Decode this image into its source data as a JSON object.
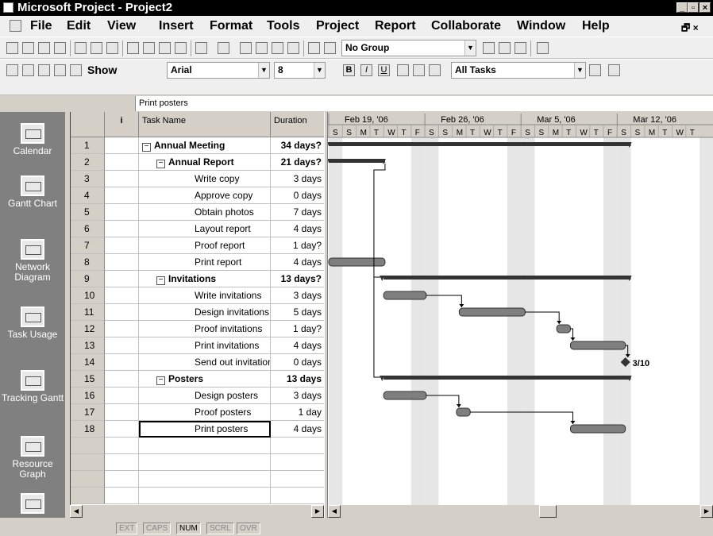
{
  "window": {
    "title": "Microsoft Project - Project2"
  },
  "menu": [
    "File",
    "Edit",
    "View",
    "Insert",
    "Format",
    "Tools",
    "Project",
    "Report",
    "Collaborate",
    "Window",
    "Help"
  ],
  "toolbar": {
    "group_value": "No Group",
    "show_label": "Show",
    "font_value": "Arial",
    "size_value": "8",
    "filter_value": "All Tasks"
  },
  "entry_bar": {
    "value": "Print posters"
  },
  "view_bar": [
    "Calendar",
    "Gantt Chart",
    "Network Diagram",
    "Task Usage",
    "Tracking Gantt",
    "Resource Graph"
  ],
  "table": {
    "headers": {
      "indicator": "i",
      "name": "Task Name",
      "duration": "Duration"
    },
    "rows": [
      {
        "id": "1",
        "name": "Annual Meeting",
        "duration": "34 days?",
        "level": 0,
        "summary": true
      },
      {
        "id": "2",
        "name": "Annual Report",
        "duration": "21 days?",
        "level": 1,
        "summary": true
      },
      {
        "id": "3",
        "name": "Write copy",
        "duration": "3 days",
        "level": 2,
        "summary": false
      },
      {
        "id": "4",
        "name": "Approve copy",
        "duration": "0 days",
        "level": 2,
        "summary": false
      },
      {
        "id": "5",
        "name": "Obtain photos",
        "duration": "7 days",
        "level": 2,
        "summary": false
      },
      {
        "id": "6",
        "name": "Layout report",
        "duration": "4 days",
        "level": 2,
        "summary": false
      },
      {
        "id": "7",
        "name": "Proof report",
        "duration": "1 day?",
        "level": 2,
        "summary": false
      },
      {
        "id": "8",
        "name": "Print report",
        "duration": "4 days",
        "level": 2,
        "summary": false
      },
      {
        "id": "9",
        "name": "Invitations",
        "duration": "13 days?",
        "level": 1,
        "summary": true
      },
      {
        "id": "10",
        "name": "Write invitations",
        "duration": "3 days",
        "level": 2,
        "summary": false
      },
      {
        "id": "11",
        "name": "Design invitations",
        "duration": "5 days",
        "level": 2,
        "summary": false
      },
      {
        "id": "12",
        "name": "Proof invitations",
        "duration": "1 day?",
        "level": 2,
        "summary": false
      },
      {
        "id": "13",
        "name": "Print invitations",
        "duration": "4 days",
        "level": 2,
        "summary": false
      },
      {
        "id": "14",
        "name": "Send out invitations",
        "duration": "0 days",
        "level": 2,
        "summary": false
      },
      {
        "id": "15",
        "name": "Posters",
        "duration": "13 days",
        "level": 1,
        "summary": true
      },
      {
        "id": "16",
        "name": "Design posters",
        "duration": "3 days",
        "level": 2,
        "summary": false
      },
      {
        "id": "17",
        "name": "Proof posters",
        "duration": "1 day",
        "level": 2,
        "summary": false
      },
      {
        "id": "18",
        "name": "Print posters",
        "duration": "4 days",
        "level": 2,
        "summary": false,
        "selected": true
      }
    ]
  },
  "gantt": {
    "weeks": [
      "Feb 19, '06",
      "Feb 26, '06",
      "Mar 5, '06",
      "Mar 12, '06"
    ],
    "days": [
      "S",
      "S",
      "M",
      "T",
      "W",
      "T",
      "F",
      "S",
      "S",
      "M",
      "T",
      "W",
      "T",
      "F",
      "S",
      "S",
      "M",
      "T",
      "W",
      "T",
      "F",
      "S",
      "S",
      "M",
      "T",
      "W",
      "T"
    ],
    "milestone_label": "3/10",
    "bar_color": "#7f7f7f",
    "summary_color": "#333333"
  },
  "status": [
    "EXT",
    "CAPS",
    "NUM",
    "SCRL",
    "OVR"
  ]
}
